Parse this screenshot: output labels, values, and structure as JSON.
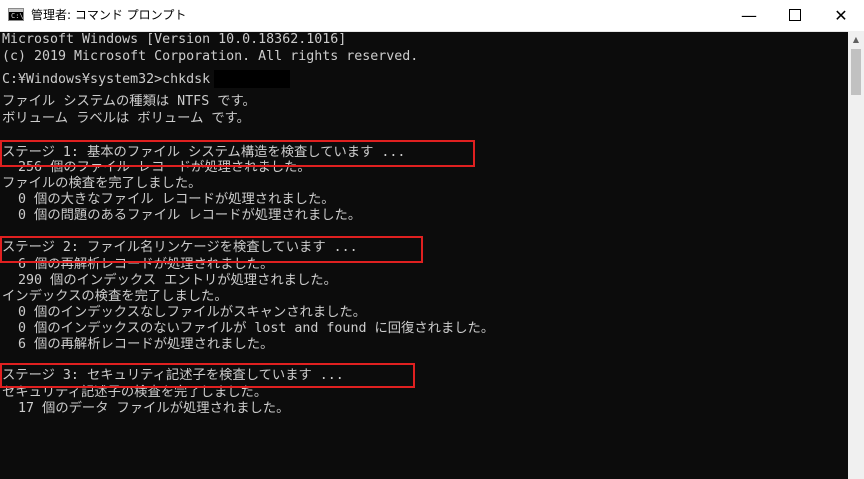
{
  "window": {
    "title": "管理者: コマンド プロンプト",
    "icon_label": "C:\\",
    "controls": {
      "minimize": "—",
      "close": "✕"
    }
  },
  "console": {
    "lines": [
      "Microsoft Windows [Version 10.0.18362.1016]",
      "(c) 2019 Microsoft Corporation. All rights reserved.",
      "",
      "C:¥Windows¥system32>chkdsk",
      "ファイル システムの種類は NTFS です。",
      "ボリューム ラベルは ボリューム です。",
      "",
      "ステージ 1: 基本のファイル システム構造を検査しています ...",
      "  256 個のファイル レコードが処理されました。",
      "ファイルの検査を完了しました。",
      "  0 個の大きなファイル レコードが処理されました。",
      "  0 個の問題のあるファイル レコードが処理されました。",
      "",
      "ステージ 2: ファイル名リンケージを検査しています ...",
      "  6 個の再解析レコードが処理されました。",
      "  290 個のインデックス エントリが処理されました。",
      "インデックスの検査を完了しました。",
      "  0 個のインデックスなしファイルがスキャンされました。",
      "  0 個のインデックスのないファイルが lost and found に回復されました。",
      "  6 個の再解析レコードが処理されました。",
      "",
      "ステージ 3: セキュリティ記述子を検査しています ...",
      "セキュリティ記述子の検査を完了しました。",
      "  17 個のデータ ファイルが処理されました。"
    ]
  },
  "colors": {
    "console_bg": "#0c0c0c",
    "console_text": "#cccccc",
    "highlight": "#e02020"
  }
}
